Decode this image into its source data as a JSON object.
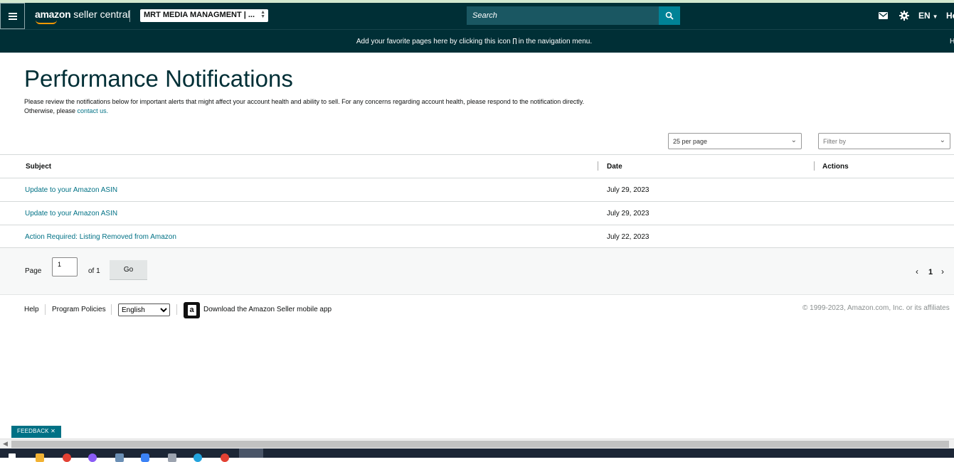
{
  "header": {
    "logo_brand": "amazon",
    "logo_product": "seller central",
    "account_name": "MRT MEDIA MANAGMENT | ...",
    "search_placeholder": "Search",
    "language": "EN",
    "cut_text": "He"
  },
  "favorites_bar": {
    "message_before": "Add your favorite pages here by clicking this icon",
    "message_after": "in the navigation menu.",
    "cut_text": "H"
  },
  "page": {
    "title": "Performance Notifications",
    "intro_line1": "Please review the notifications below for important alerts that might affect your account health and ability to sell. For any concerns regarding account health, please respond to the notification directly.",
    "intro_line2_prefix": "Otherwise, please ",
    "intro_link": "contact us."
  },
  "controls": {
    "per_page": "25 per page",
    "filter_placeholder": "Filter by"
  },
  "table": {
    "headers": [
      "Subject",
      "Date",
      "Actions"
    ],
    "rows": [
      {
        "subject": "Update to your Amazon ASIN",
        "date": "July 29, 2023"
      },
      {
        "subject": "Update to your Amazon ASIN",
        "date": "July 29, 2023"
      },
      {
        "subject": "Action Required: Listing Removed from Amazon",
        "date": "July 22, 2023"
      }
    ]
  },
  "pagination": {
    "page_label": "Page",
    "page_value": "1",
    "of_label": "of 1",
    "go_label": "Go",
    "current_page": "1"
  },
  "footer": {
    "help": "Help",
    "program_policies": "Program Policies",
    "language_option": "English",
    "app_link": "Download the Amazon Seller mobile app",
    "copyright": "© 1999-2023, Amazon.com, Inc. or its affiliates"
  },
  "feedback": {
    "label": "FEEDBACK"
  },
  "colors": {
    "nav_bg": "#002f36",
    "link": "#007185",
    "search_btn": "#008296",
    "logo_smile": "#ff9900"
  }
}
